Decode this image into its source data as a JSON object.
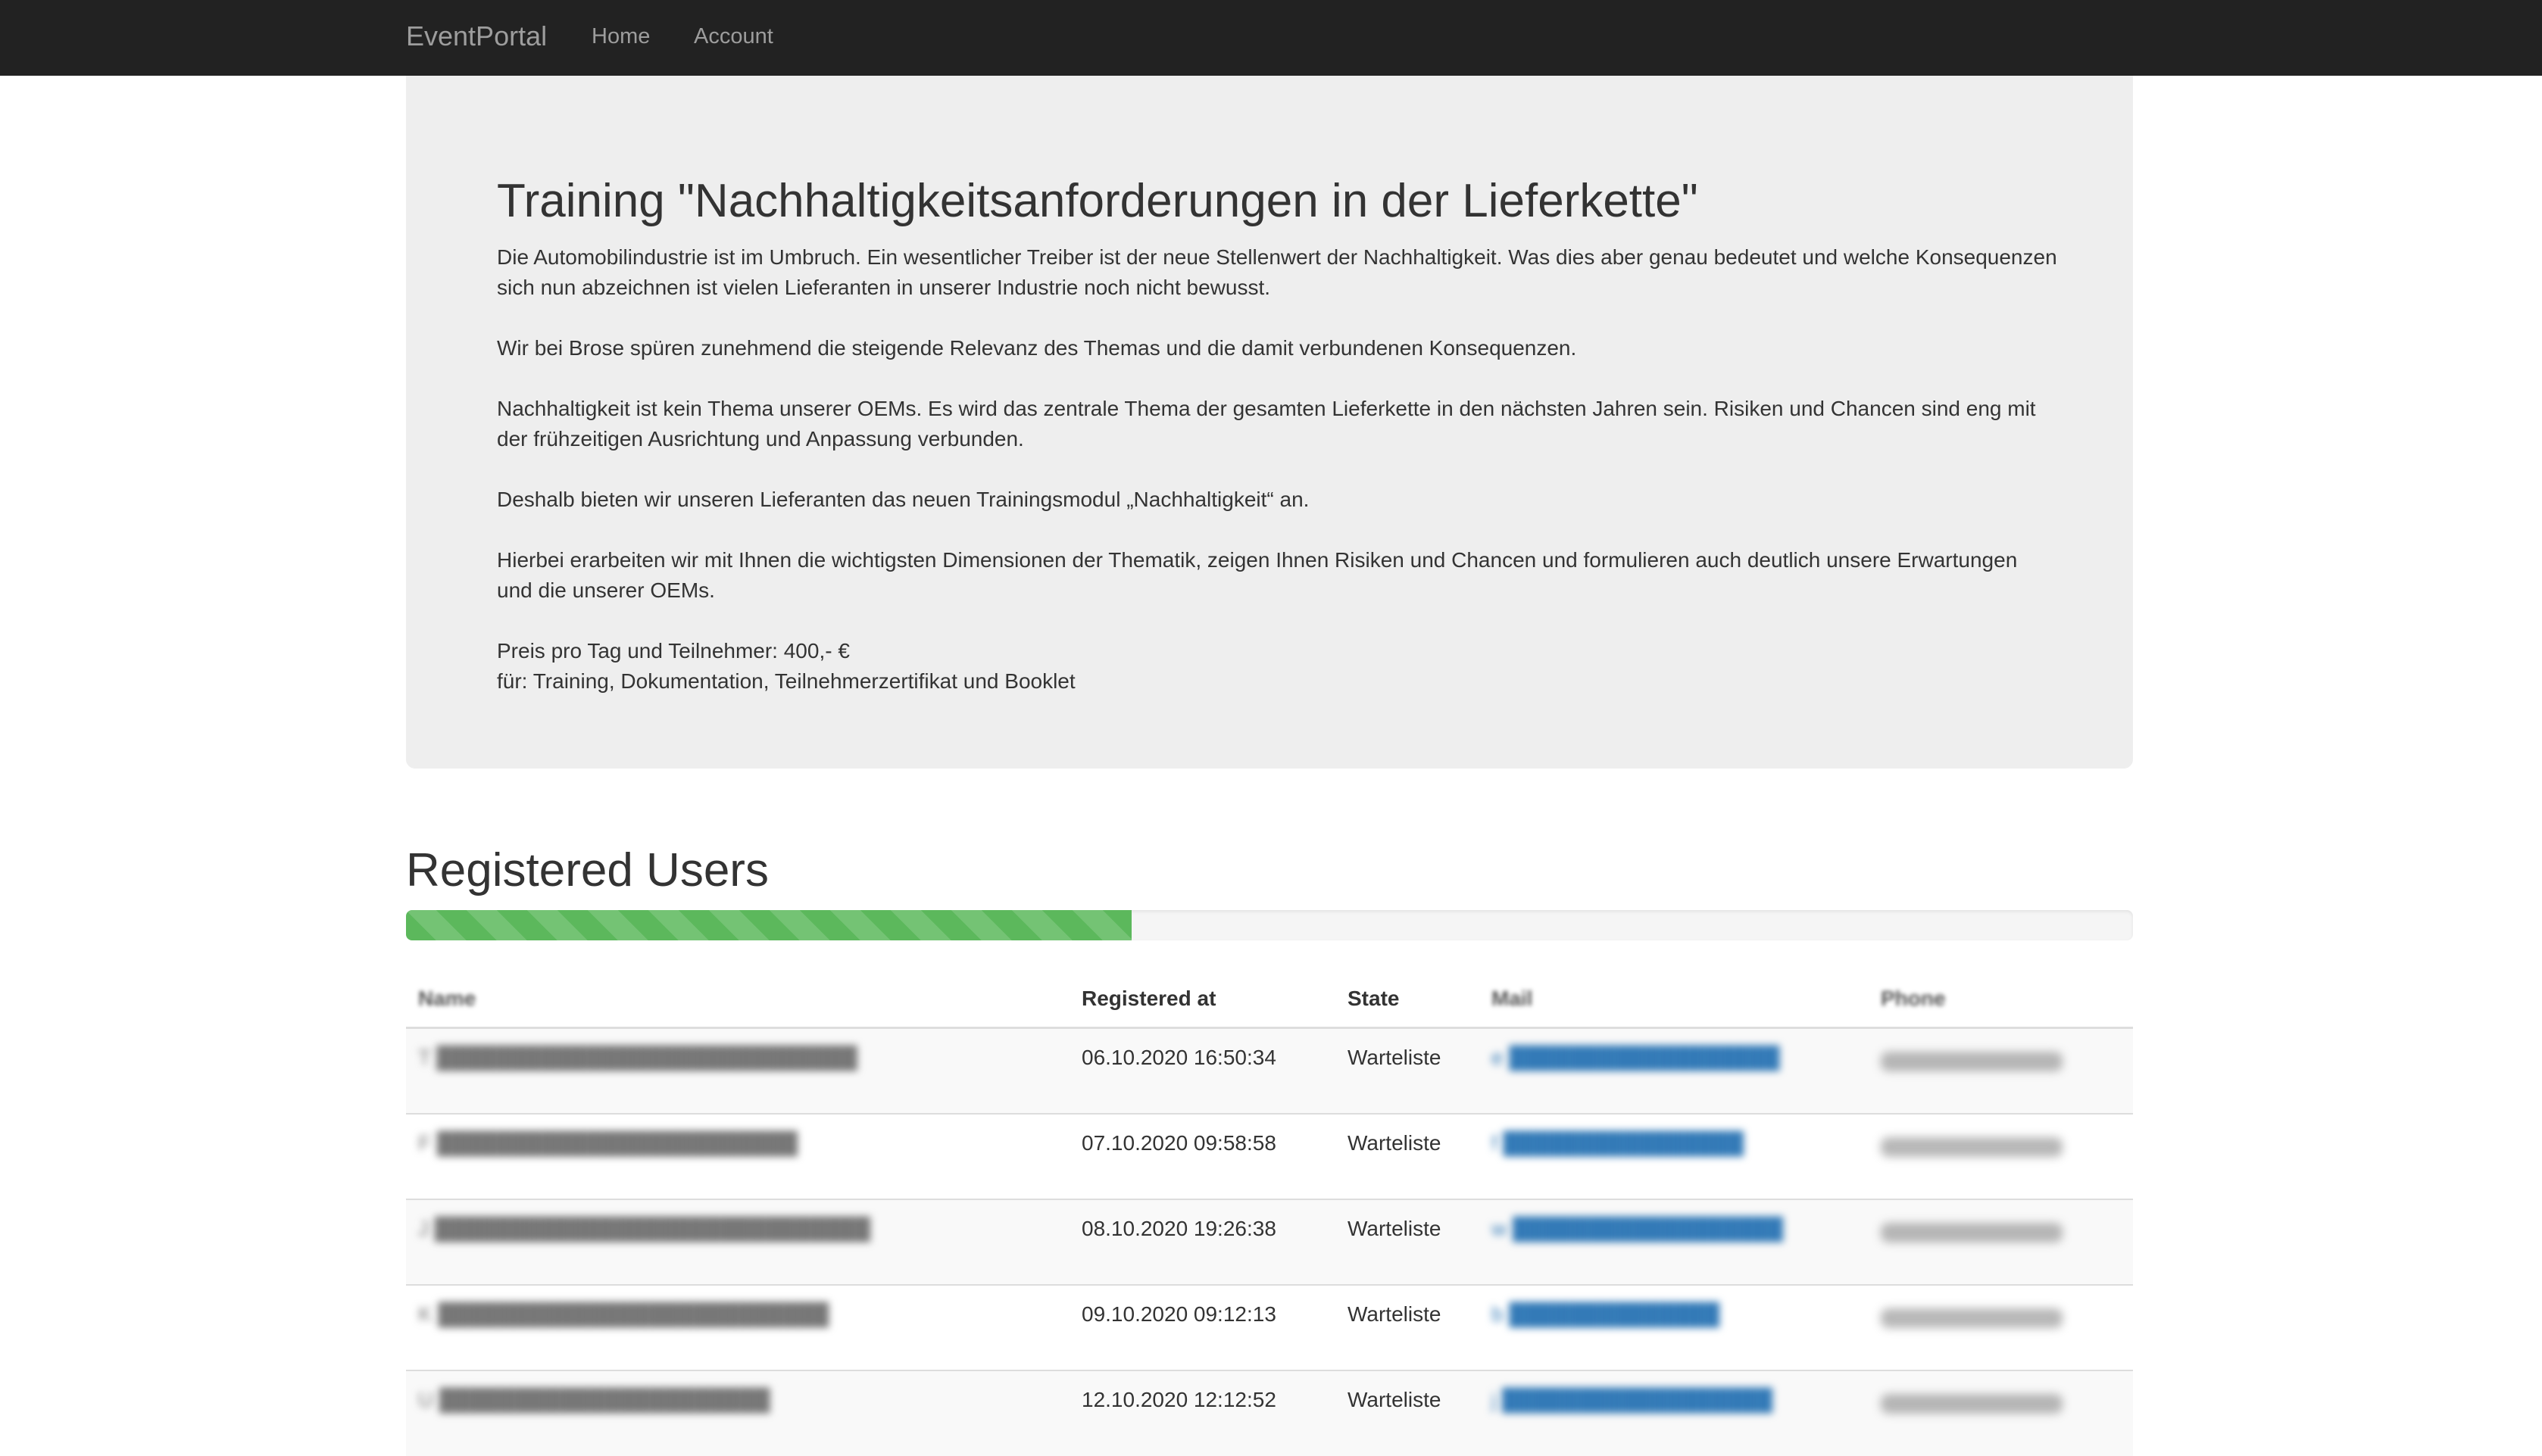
{
  "navbar": {
    "brand": "EventPortal",
    "links": [
      "Home",
      "Account"
    ]
  },
  "event": {
    "title": "Training \"Nachhaltigkeitsanforderungen in der Lieferkette\"",
    "paragraphs": [
      "Die Automobilindustrie ist im Umbruch. Ein wesentlicher Treiber ist der neue Stellenwert der Nachhaltigkeit. Was dies aber genau bedeutet und welche Konsequenzen sich nun abzeichnen ist vielen Lieferanten in unserer Industrie noch nicht bewusst.",
      "Wir bei Brose spüren zunehmend die steigende Relevanz des Themas und die damit verbundenen Konsequenzen.",
      "Nachhaltigkeit ist kein Thema unserer OEMs. Es wird das zentrale Thema der gesamten Lieferkette in den nächsten Jahren sein. Risiken und Chancen sind eng mit der frühzeitigen Ausrichtung und Anpassung verbunden.",
      "Deshalb bieten wir unseren Lieferanten das neuen Trainingsmodul „Nachhaltigkeit“ an.",
      "Hierbei erarbeiten wir mit Ihnen die wichtigsten Dimensionen der Thematik, zeigen Ihnen Risiken und Chancen und formulieren auch deutlich unsere Erwartungen und die unserer OEMs.",
      "Preis pro Tag und Teilnehmer: 400,- €\nfür: Training, Dokumentation, Teilnehmerzertifikat und Booklet"
    ]
  },
  "registered": {
    "title": "Registered Users",
    "progress_percent": 42,
    "progress_color": "#5cb85c",
    "columns": [
      "Name",
      "Registered at",
      "State",
      "Mail",
      "Phone"
    ],
    "rows": [
      {
        "name": "T",
        "registered_at": "06.10.2020 16:50:34",
        "state": "Warteliste",
        "mail": "e"
      },
      {
        "name": "F",
        "registered_at": "07.10.2020 09:58:58",
        "state": "Warteliste",
        "mail": "f"
      },
      {
        "name": "J",
        "registered_at": "08.10.2020 19:26:38",
        "state": "Warteliste",
        "mail": "w"
      },
      {
        "name": "K",
        "registered_at": "09.10.2020 09:12:13",
        "state": "Warteliste",
        "mail": "b"
      },
      {
        "name": "U",
        "registered_at": "12.10.2020 12:12:52",
        "state": "Warteliste",
        "mail": "j"
      }
    ]
  }
}
